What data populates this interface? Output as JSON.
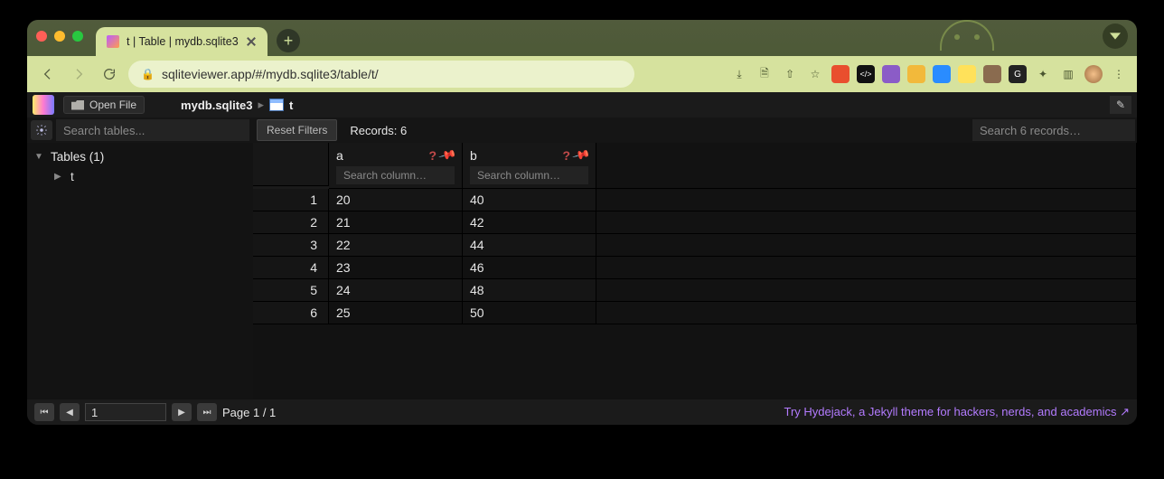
{
  "browser": {
    "tab_title": "t | Table | mydb.sqlite3",
    "url": "sqliteviewer.app/#/mydb.sqlite3/table/t/"
  },
  "app": {
    "open_file_label": "Open File",
    "breadcrumb_db": "mydb.sqlite3",
    "breadcrumb_table": "t",
    "search_tables_placeholder": "Search tables...",
    "reset_filters_label": "Reset Filters",
    "records_label": "Records: 6",
    "search_records_placeholder": "Search 6 records…",
    "sidebar": {
      "tables_header": "Tables (1)",
      "items": [
        "t"
      ]
    },
    "columns": [
      {
        "name": "a",
        "search_placeholder": "Search column…"
      },
      {
        "name": "b",
        "search_placeholder": "Search column…"
      }
    ],
    "rows": [
      {
        "n": "1",
        "a": "20",
        "b": "40"
      },
      {
        "n": "2",
        "a": "21",
        "b": "42"
      },
      {
        "n": "3",
        "a": "22",
        "b": "44"
      },
      {
        "n": "4",
        "a": "23",
        "b": "46"
      },
      {
        "n": "5",
        "a": "24",
        "b": "48"
      },
      {
        "n": "6",
        "a": "25",
        "b": "50"
      }
    ],
    "footer": {
      "page_input": "1",
      "page_label": "Page 1 / 1",
      "promo": "Try Hydejack, a Jekyll theme for hackers, nerds, and academics ↗"
    }
  }
}
